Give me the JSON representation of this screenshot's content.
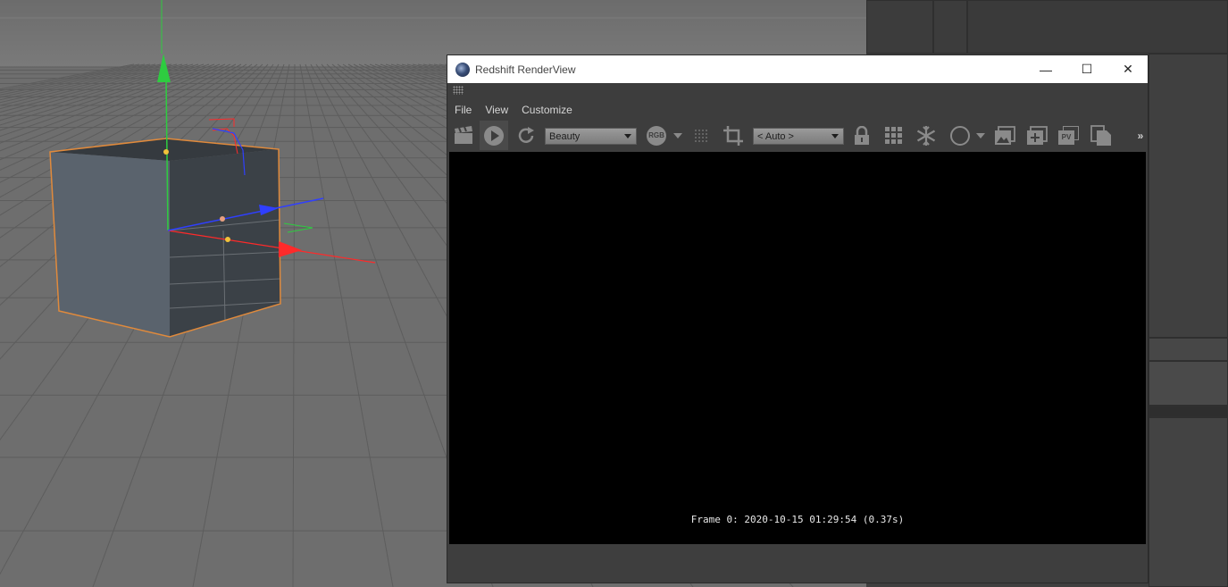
{
  "window": {
    "title": "Redshift RenderView",
    "minimize_label": "—",
    "maximize_label": "☐",
    "close_label": "✕"
  },
  "menu": {
    "items": [
      "File",
      "View",
      "Customize"
    ]
  },
  "toolbar": {
    "aov_dropdown": "Beauty",
    "rgb_label": "RGB",
    "crop_dropdown": "< Auto >",
    "pv_label": "PV",
    "overflow_label": "»"
  },
  "canvas": {
    "status_text": "Frame 0: 2020-10-15 01:29:54 (0.37s)"
  },
  "colors": {
    "axis_y": "#2ecc40",
    "axis_x": "#ff2a2a",
    "axis_z": "#2f3fff",
    "selection": "#e08a3c",
    "titlebar": "#ffffff",
    "canvas": "#000000"
  },
  "icons": [
    "clapper-icon",
    "play-icon",
    "refresh-icon",
    "rgb-icon",
    "grid-dots-icon",
    "crop-icon",
    "lock-icon",
    "tile-grid-icon",
    "snowflake-icon",
    "circle-icon",
    "image-icon",
    "add-snapshot-icon",
    "pv-icon",
    "copy-icon"
  ]
}
